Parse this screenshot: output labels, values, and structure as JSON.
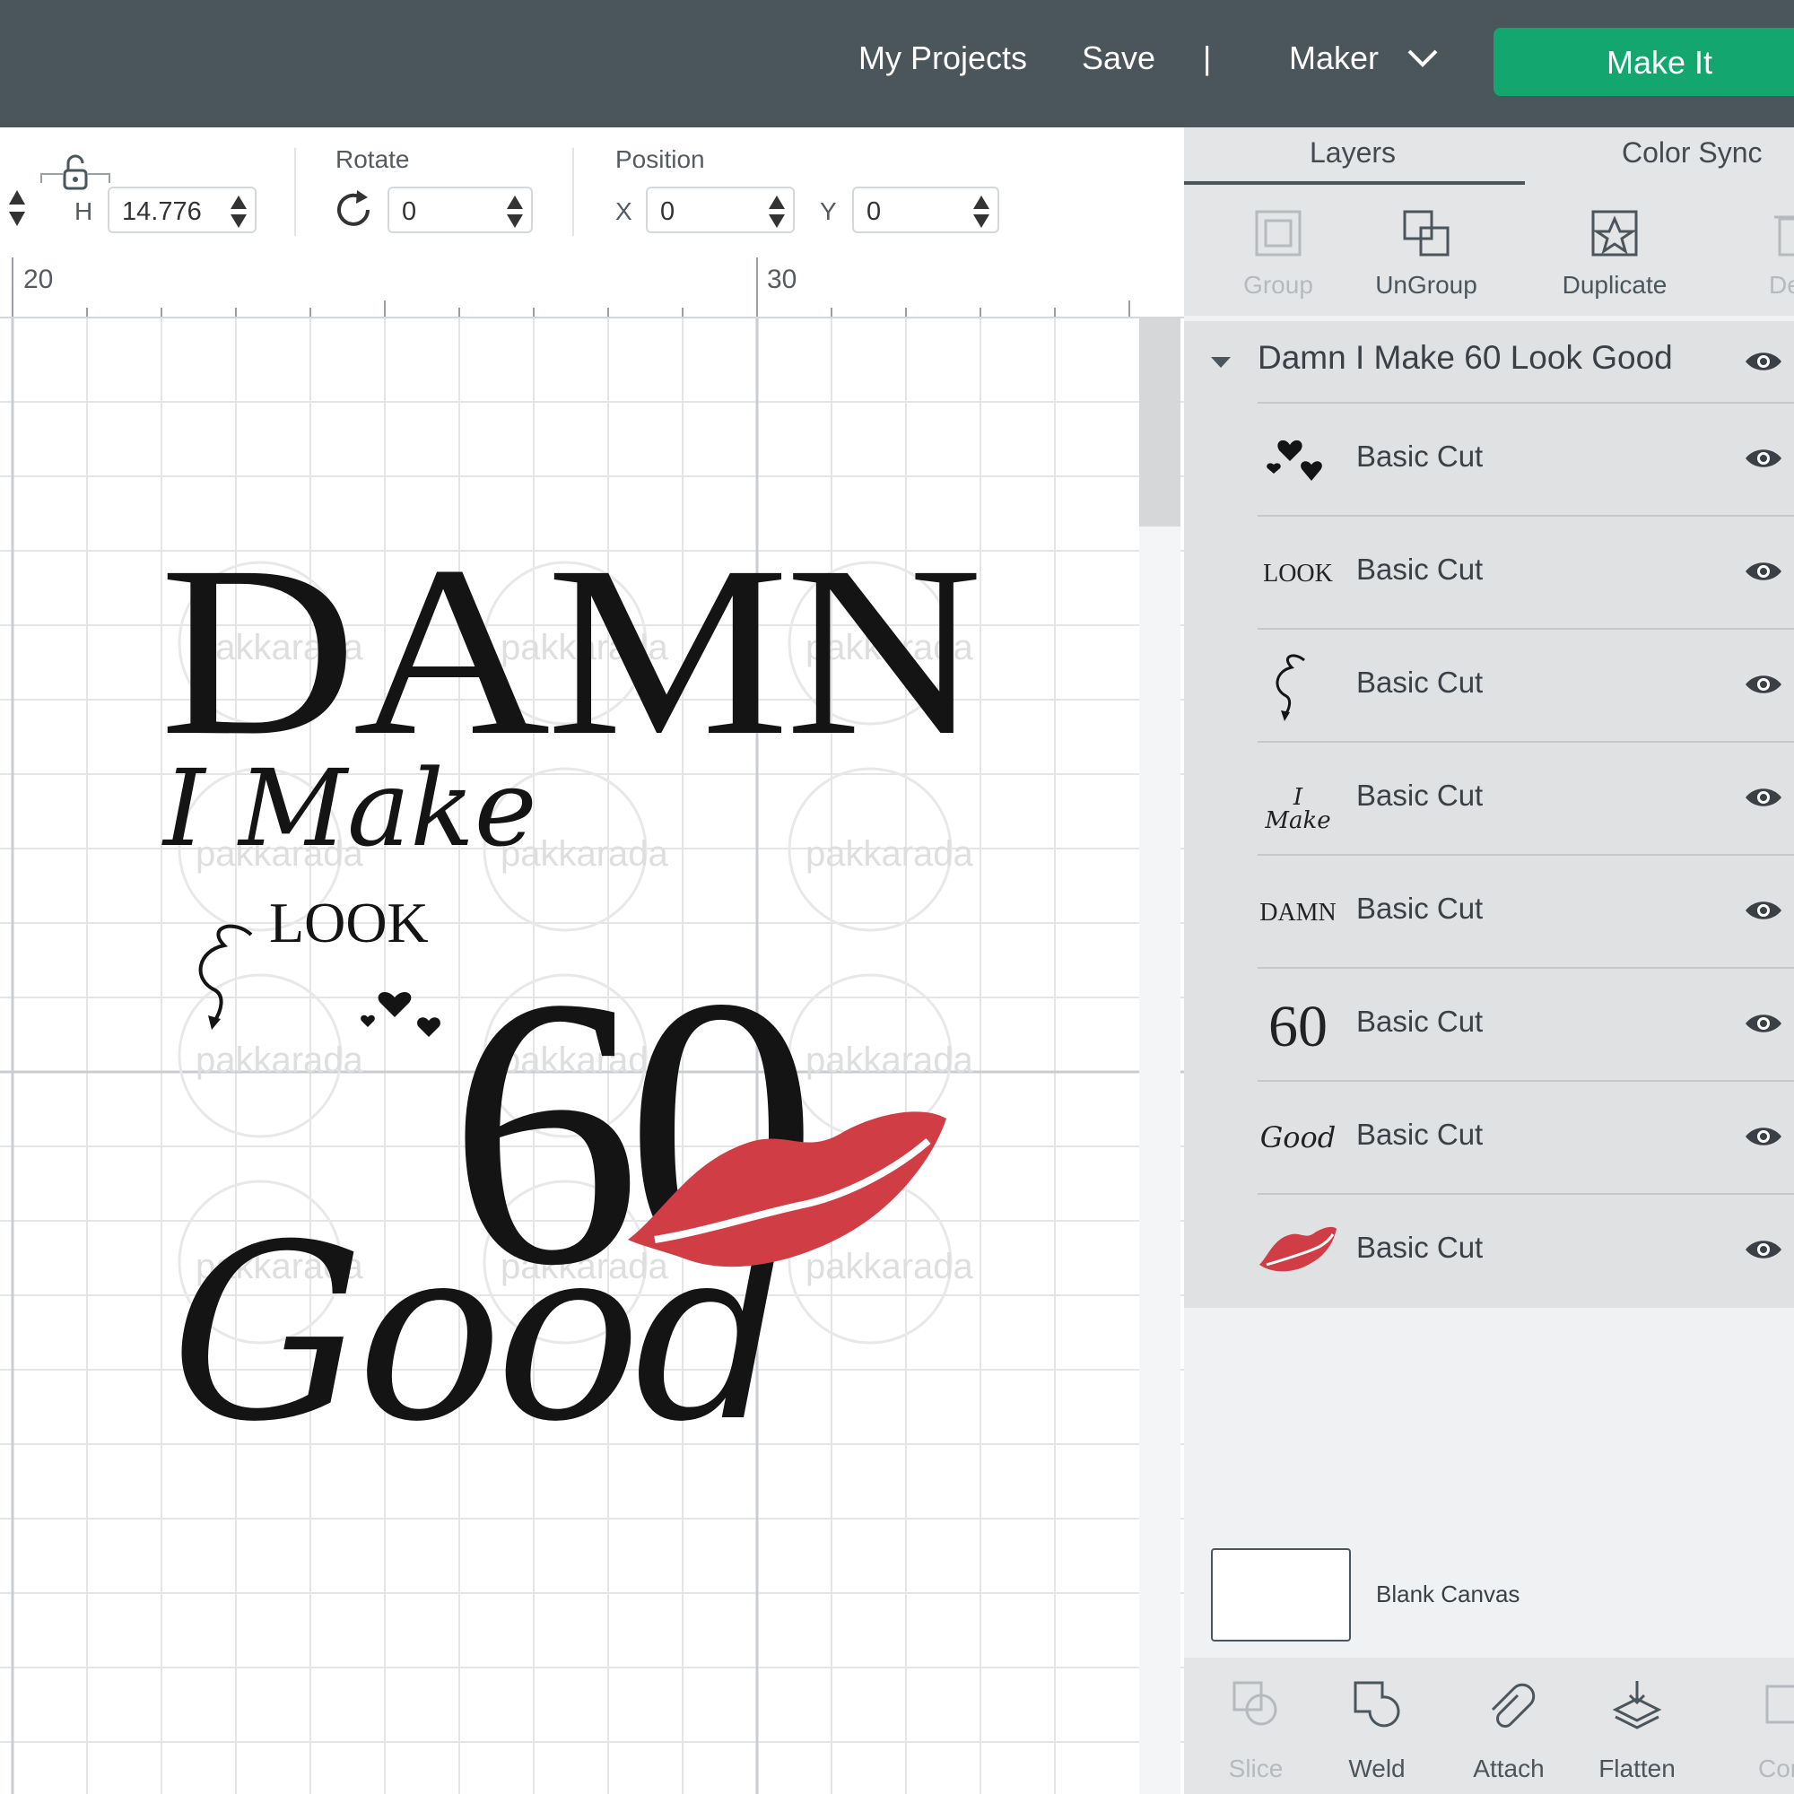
{
  "header": {
    "my_projects": "My Projects",
    "save": "Save",
    "separator": "|",
    "machine": "Maker",
    "make_it": "Make It",
    "accent": "#14a66f",
    "bar_color": "#4b555c"
  },
  "toolbar": {
    "h_label": "H",
    "h_value": "14.776",
    "rotate_label": "Rotate",
    "rotate_value": "0",
    "position_label": "Position",
    "x_label": "X",
    "x_value": "0",
    "y_label": "Y",
    "y_value": "0"
  },
  "ruler": {
    "mark_a": "20",
    "mark_b": "30"
  },
  "design": {
    "line1": "DAMN",
    "line2": "I Make",
    "line3": "LOOK",
    "line4": "60",
    "line5": "Good",
    "watermark": "pakkarada",
    "lip_color": "#d13d45"
  },
  "panel": {
    "tabs": [
      "Layers",
      "Color Sync"
    ],
    "actions": [
      {
        "label": "Group",
        "icon": "group-icon",
        "enabled": false
      },
      {
        "label": "UnGroup",
        "icon": "ungroup-icon",
        "enabled": true
      },
      {
        "label": "Duplicate",
        "icon": "duplicate-icon",
        "enabled": true
      },
      {
        "label": "Dele",
        "icon": "delete-icon",
        "enabled": false
      }
    ],
    "group_name": "Damn I Make 60 Look Good",
    "layers": [
      {
        "thumb": "hearts",
        "name": "Basic Cut"
      },
      {
        "thumb": "LOOK",
        "name": "Basic Cut"
      },
      {
        "thumb": "ampersand",
        "name": "Basic Cut"
      },
      {
        "thumb": "I Make",
        "name": "Basic Cut"
      },
      {
        "thumb": "DAMN",
        "name": "Basic Cut"
      },
      {
        "thumb": "60",
        "name": "Basic Cut"
      },
      {
        "thumb": "Good",
        "name": "Basic Cut"
      },
      {
        "thumb": "lips",
        "name": "Basic Cut"
      }
    ],
    "canvas_label": "Blank Canvas",
    "bottom_actions": [
      {
        "label": "Slice",
        "icon": "slice-icon",
        "enabled": false
      },
      {
        "label": "Weld",
        "icon": "weld-icon",
        "enabled": true
      },
      {
        "label": "Attach",
        "icon": "attach-icon",
        "enabled": true
      },
      {
        "label": "Flatten",
        "icon": "flatten-icon",
        "enabled": true
      },
      {
        "label": "Cont",
        "icon": "contour-icon",
        "enabled": false
      }
    ]
  }
}
